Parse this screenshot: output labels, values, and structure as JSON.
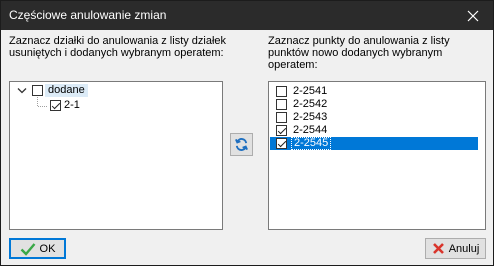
{
  "window": {
    "title": "Częściowe anulowanie zmian"
  },
  "left": {
    "instruction": "Zaznacz działki do anulowania z listy działek\nusuniętych i dodanych wybranym operatem:",
    "tree": {
      "root": {
        "label": "dodane",
        "checked": false,
        "expanded": true
      },
      "children": [
        {
          "label": "2-1",
          "checked": true
        }
      ]
    }
  },
  "right": {
    "instruction": "Zaznacz punkty do anulowania z listy\npunktów nowo dodanych wybranym\noperatem:",
    "items": [
      {
        "label": "2-2541",
        "checked": false,
        "selected": false
      },
      {
        "label": "2-2542",
        "checked": false,
        "selected": false
      },
      {
        "label": "2-2543",
        "checked": false,
        "selected": false
      },
      {
        "label": "2-2544",
        "checked": true,
        "selected": false
      },
      {
        "label": "2-2545",
        "checked": true,
        "selected": true
      }
    ]
  },
  "buttons": {
    "ok": "OK",
    "cancel": "Anuluj"
  },
  "icons": {
    "refresh": "refresh-icon",
    "ok": "check-icon",
    "cancel": "x-icon",
    "close": "close-icon",
    "expand": "chevron-down-icon"
  },
  "colors": {
    "titlebar": "#2b2b2b",
    "selection": "#0078d7",
    "ok_check": "#3aa847",
    "cancel_x": "#d9342b",
    "refresh": "#1e6fc0"
  }
}
